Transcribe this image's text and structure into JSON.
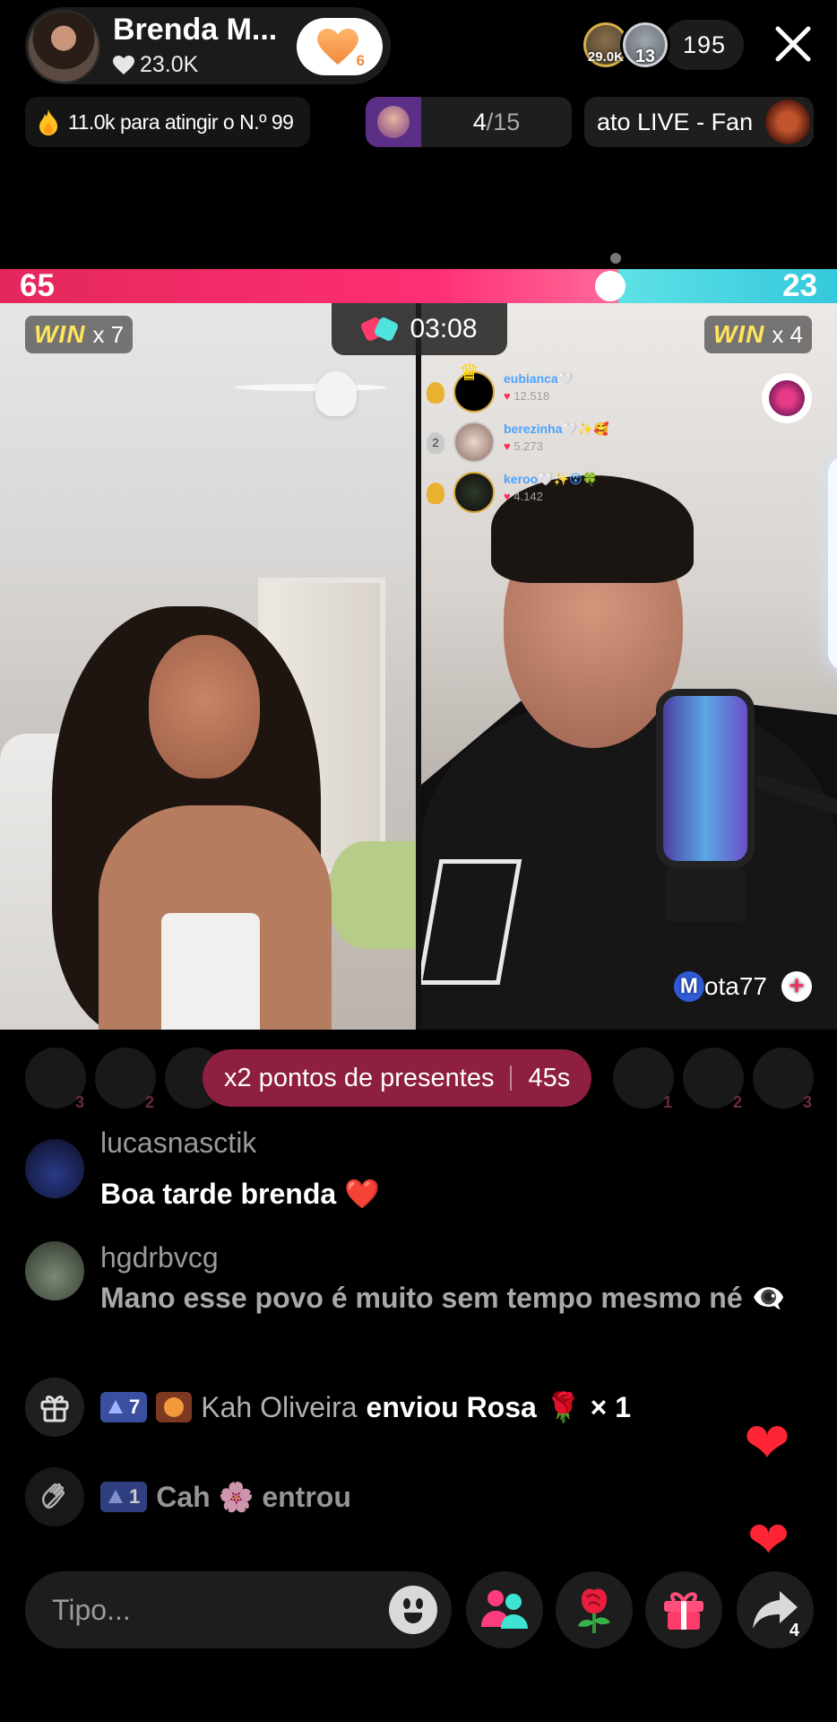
{
  "header": {
    "host_name": "Brenda M...",
    "host_likes": "23.0K",
    "follow_badge": "6",
    "viewer_badges": [
      "29.0K",
      "13"
    ],
    "viewer_count": "195",
    "rank_text": "11.0k para atingir o N.º 99",
    "mission_progress": "4",
    "mission_total": "/15",
    "event_text": "ato LIVE - Fan"
  },
  "battle": {
    "score_left": "65",
    "score_right": "23",
    "timer": "03:08",
    "win_label": "WIN",
    "win_left": "x 7",
    "win_right": "x 4",
    "guest_initial": "M",
    "guest_name": "ota77",
    "guest_follow": "+",
    "top_gifters": [
      {
        "name": "eubianca🤍",
        "points": "12.518"
      },
      {
        "name": "berezinha🤍✨🥰",
        "points": "5.273"
      },
      {
        "name": "keroo🤍✨😵🍀",
        "points": "4.142"
      }
    ],
    "gifter_medal_labels": [
      "",
      "2",
      ""
    ]
  },
  "gifter_strip": {
    "left_counts": [
      "3",
      "2",
      ""
    ],
    "right_counts": [
      "1",
      "2",
      "3"
    ]
  },
  "banner": {
    "text": "x2 pontos de presentes",
    "countdown": "45s"
  },
  "chat": [
    {
      "user": "lucasnasctik",
      "message": "Boa tarde brenda",
      "emoji": "❤️"
    },
    {
      "user": "hgdrbvcg",
      "message": "Mano esse povo é muito sem tempo mesmo né",
      "emoji": "👁‍🗨"
    }
  ],
  "gift_event": {
    "level": "7",
    "sender": "Kah Oliveira",
    "action": "enviou Rosa",
    "gift_emoji": "🌹",
    "count": "× 1"
  },
  "join_event": {
    "level": "1",
    "text": "Cah 🌸 entrou"
  },
  "input": {
    "placeholder": "Tipo..."
  },
  "actions": {
    "share_count": "4"
  },
  "colors": {
    "battle_left": "#ff2f73",
    "battle_right": "#46d4e0",
    "banner": "#8e1f3f",
    "win": "#ffe45c"
  }
}
